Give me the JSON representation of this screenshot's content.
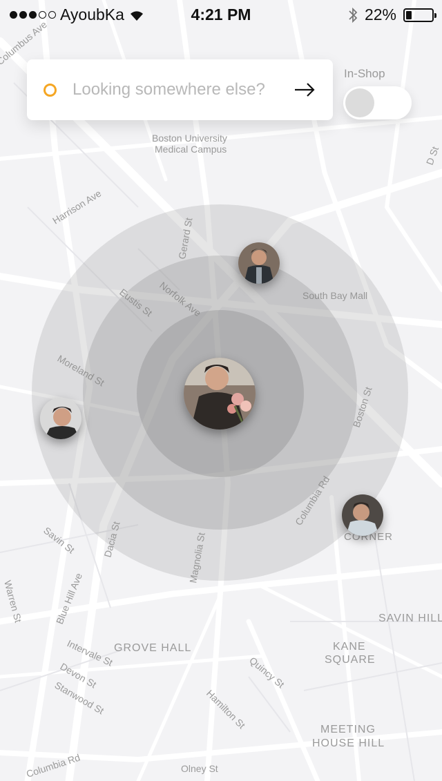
{
  "status_bar": {
    "carrier": "AyoubKa",
    "time": "4:21 PM",
    "battery_text": "22%",
    "battery_level_percent": 22,
    "signal_bars_filled": 3,
    "signal_bars_total": 5
  },
  "search": {
    "placeholder": "Looking somewhere else?",
    "icon_color": "#f5a623"
  },
  "toggle": {
    "label": "In-Shop",
    "state": "off"
  },
  "map_labels": {
    "boston_university_1": "Boston University",
    "boston_university_2": "Medical Campus",
    "harrison": "Harrison Ave",
    "gerard": "Gerard St",
    "eustis": "Eustis St",
    "norfolk": "Norfolk Ave",
    "south_bay": "South Bay Mall",
    "moreland": "Moreland St",
    "boston_st": "Boston St",
    "columbia": "Columbia Rd",
    "savin": "Savin St",
    "dacia": "Dacia St",
    "magnolia": "Magnolia St",
    "corner": "CORNER",
    "warren": "Warren St",
    "blue_hill": "Blue Hill Ave",
    "savin_hill": "SAVIN HILL",
    "grove_hall": "GROVE HALL",
    "intervale": "Intervale St",
    "kane_1": "KANE",
    "kane_2": "SQUARE",
    "quincy": "Quincy St",
    "devon": "Devon St",
    "stanwood": "Stanwood St",
    "hamilton": "Hamilton St",
    "meeting_1": "MEETING",
    "meeting_2": "HOUSE HILL",
    "columbia_rd_bottom": "Columbia Rd",
    "olney": "Olney St",
    "columbus": "Columbus Ave",
    "d_st": "D St"
  }
}
